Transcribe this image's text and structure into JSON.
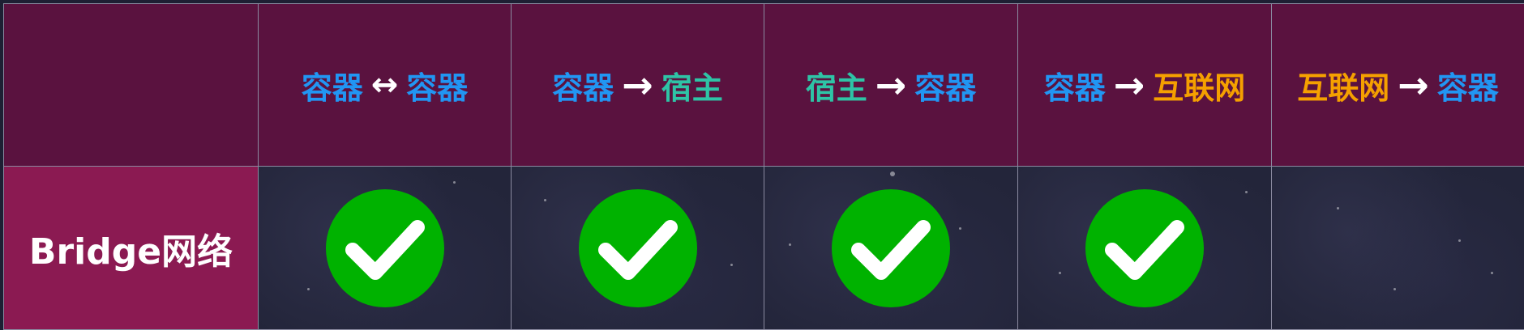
{
  "colors": {
    "container": "#2196f3",
    "host": "#2ec4a6",
    "internet": "#f5a000",
    "check": "#00b200"
  },
  "row": {
    "label": "Bridge网络"
  },
  "columns": [
    {
      "from": "容器",
      "from_type": "container",
      "arrow": "↔",
      "to": "容器",
      "to_type": "container",
      "supported": true
    },
    {
      "from": "容器",
      "from_type": "container",
      "arrow": "→",
      "to": "宿主",
      "to_type": "host",
      "supported": true
    },
    {
      "from": "宿主",
      "from_type": "host",
      "arrow": "→",
      "to": "容器",
      "to_type": "container",
      "supported": true
    },
    {
      "from": "容器",
      "from_type": "container",
      "arrow": "→",
      "to": "互联网",
      "to_type": "internet",
      "supported": true
    },
    {
      "from": "互联网",
      "from_type": "internet",
      "arrow": "→",
      "to": "容器",
      "to_type": "container",
      "supported": false
    }
  ],
  "icons": {
    "supported": "check-icon",
    "direction": "arrow-right-icon",
    "bidirectional": "double-arrow-icon"
  }
}
